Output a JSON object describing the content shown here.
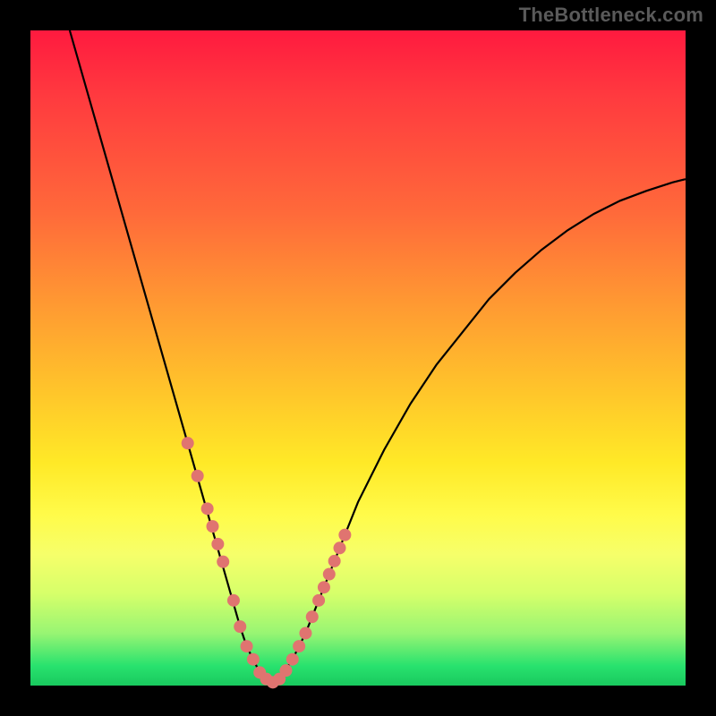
{
  "watermark": "TheBottleneck.com",
  "chart_data": {
    "type": "line",
    "title": "",
    "xlabel": "",
    "ylabel": "",
    "xlim": [
      0,
      100
    ],
    "ylim": [
      0,
      100
    ],
    "grid": false,
    "legend": false,
    "series": [
      {
        "name": "bottleneck-curve",
        "x": [
          6,
          8,
          10,
          12,
          14,
          16,
          18,
          20,
          22,
          24,
          26,
          28,
          30,
          32,
          33,
          34,
          35,
          36,
          37,
          38,
          40,
          42,
          44,
          46,
          48,
          50,
          54,
          58,
          62,
          66,
          70,
          74,
          78,
          82,
          86,
          90,
          94,
          98,
          100
        ],
        "y": [
          100,
          93,
          86,
          79,
          72,
          65,
          58,
          51,
          44,
          37,
          30,
          23,
          16,
          9,
          6,
          4,
          2,
          1,
          0.5,
          1,
          4,
          8,
          13,
          18,
          23,
          28,
          36,
          43,
          49,
          54,
          59,
          63,
          66.5,
          69.5,
          72,
          74,
          75.5,
          76.8,
          77.3
        ]
      }
    ],
    "markers": {
      "name": "highlight-dots",
      "x": [
        24.0,
        25.5,
        27.0,
        27.8,
        28.6,
        29.4,
        31.0,
        32.0,
        33.0,
        34.0,
        35.0,
        36.0,
        37.0,
        38.0,
        39.0,
        40.0,
        41.0,
        42.0,
        43.0,
        44.0,
        44.8,
        45.6,
        46.4,
        47.2,
        48.0
      ],
      "y": [
        37.0,
        32.0,
        27.0,
        24.3,
        21.6,
        18.9,
        13.0,
        9.0,
        6.0,
        4.0,
        2.0,
        1.0,
        0.5,
        1.0,
        2.3,
        4.0,
        6.0,
        8.0,
        10.5,
        13.0,
        15.0,
        17.0,
        19.0,
        21.0,
        23.0
      ],
      "r": 7
    },
    "background_gradient": {
      "direction": "top-to-bottom",
      "stops": [
        {
          "pos": 0,
          "color": "#ff1a3f"
        },
        {
          "pos": 28,
          "color": "#ff6a3a"
        },
        {
          "pos": 56,
          "color": "#ffc82a"
        },
        {
          "pos": 74,
          "color": "#fffb4a"
        },
        {
          "pos": 92,
          "color": "#98f573"
        },
        {
          "pos": 100,
          "color": "#19c95e"
        }
      ]
    }
  }
}
